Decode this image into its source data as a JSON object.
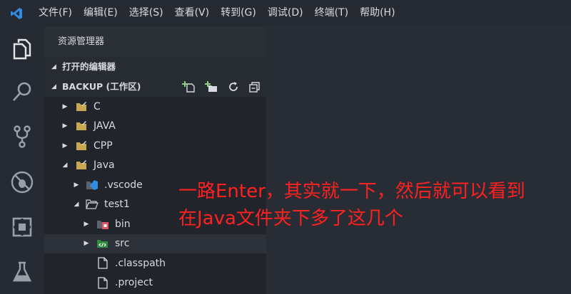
{
  "menubar": {
    "items": [
      "文件(F)",
      "编辑(E)",
      "选择(S)",
      "查看(V)",
      "转到(G)",
      "调试(D)",
      "终端(T)",
      "帮助(H)"
    ]
  },
  "sidebar": {
    "title": "资源管理器",
    "open_editors": "打开的编辑器",
    "workspace": "BACKUP (工作区)",
    "tree": [
      {
        "label": "C",
        "expanded": false,
        "type": "folder"
      },
      {
        "label": "JAVA",
        "expanded": false,
        "type": "folder"
      },
      {
        "label": "CPP",
        "expanded": false,
        "type": "folder"
      },
      {
        "label": "Java",
        "expanded": true,
        "type": "folder"
      },
      {
        "label": ".vscode",
        "expanded": false,
        "type": "vscode-folder"
      },
      {
        "label": "test1",
        "expanded": true,
        "type": "folder-open"
      },
      {
        "label": "bin",
        "expanded": false,
        "type": "bin-folder"
      },
      {
        "label": "src",
        "expanded": false,
        "type": "src-folder",
        "selected": true
      },
      {
        "label": ".classpath",
        "type": "file"
      },
      {
        "label": ".project",
        "type": "file"
      }
    ]
  },
  "annotation": {
    "line1": "一路Enter，其实就一下，然后就可以看到",
    "line2": "在Java文件夹下多了这几个",
    "color": "#ff2020"
  },
  "colors": {
    "accent": "#2f8de4",
    "background": "#262b33",
    "sidebar": "#21252b"
  }
}
